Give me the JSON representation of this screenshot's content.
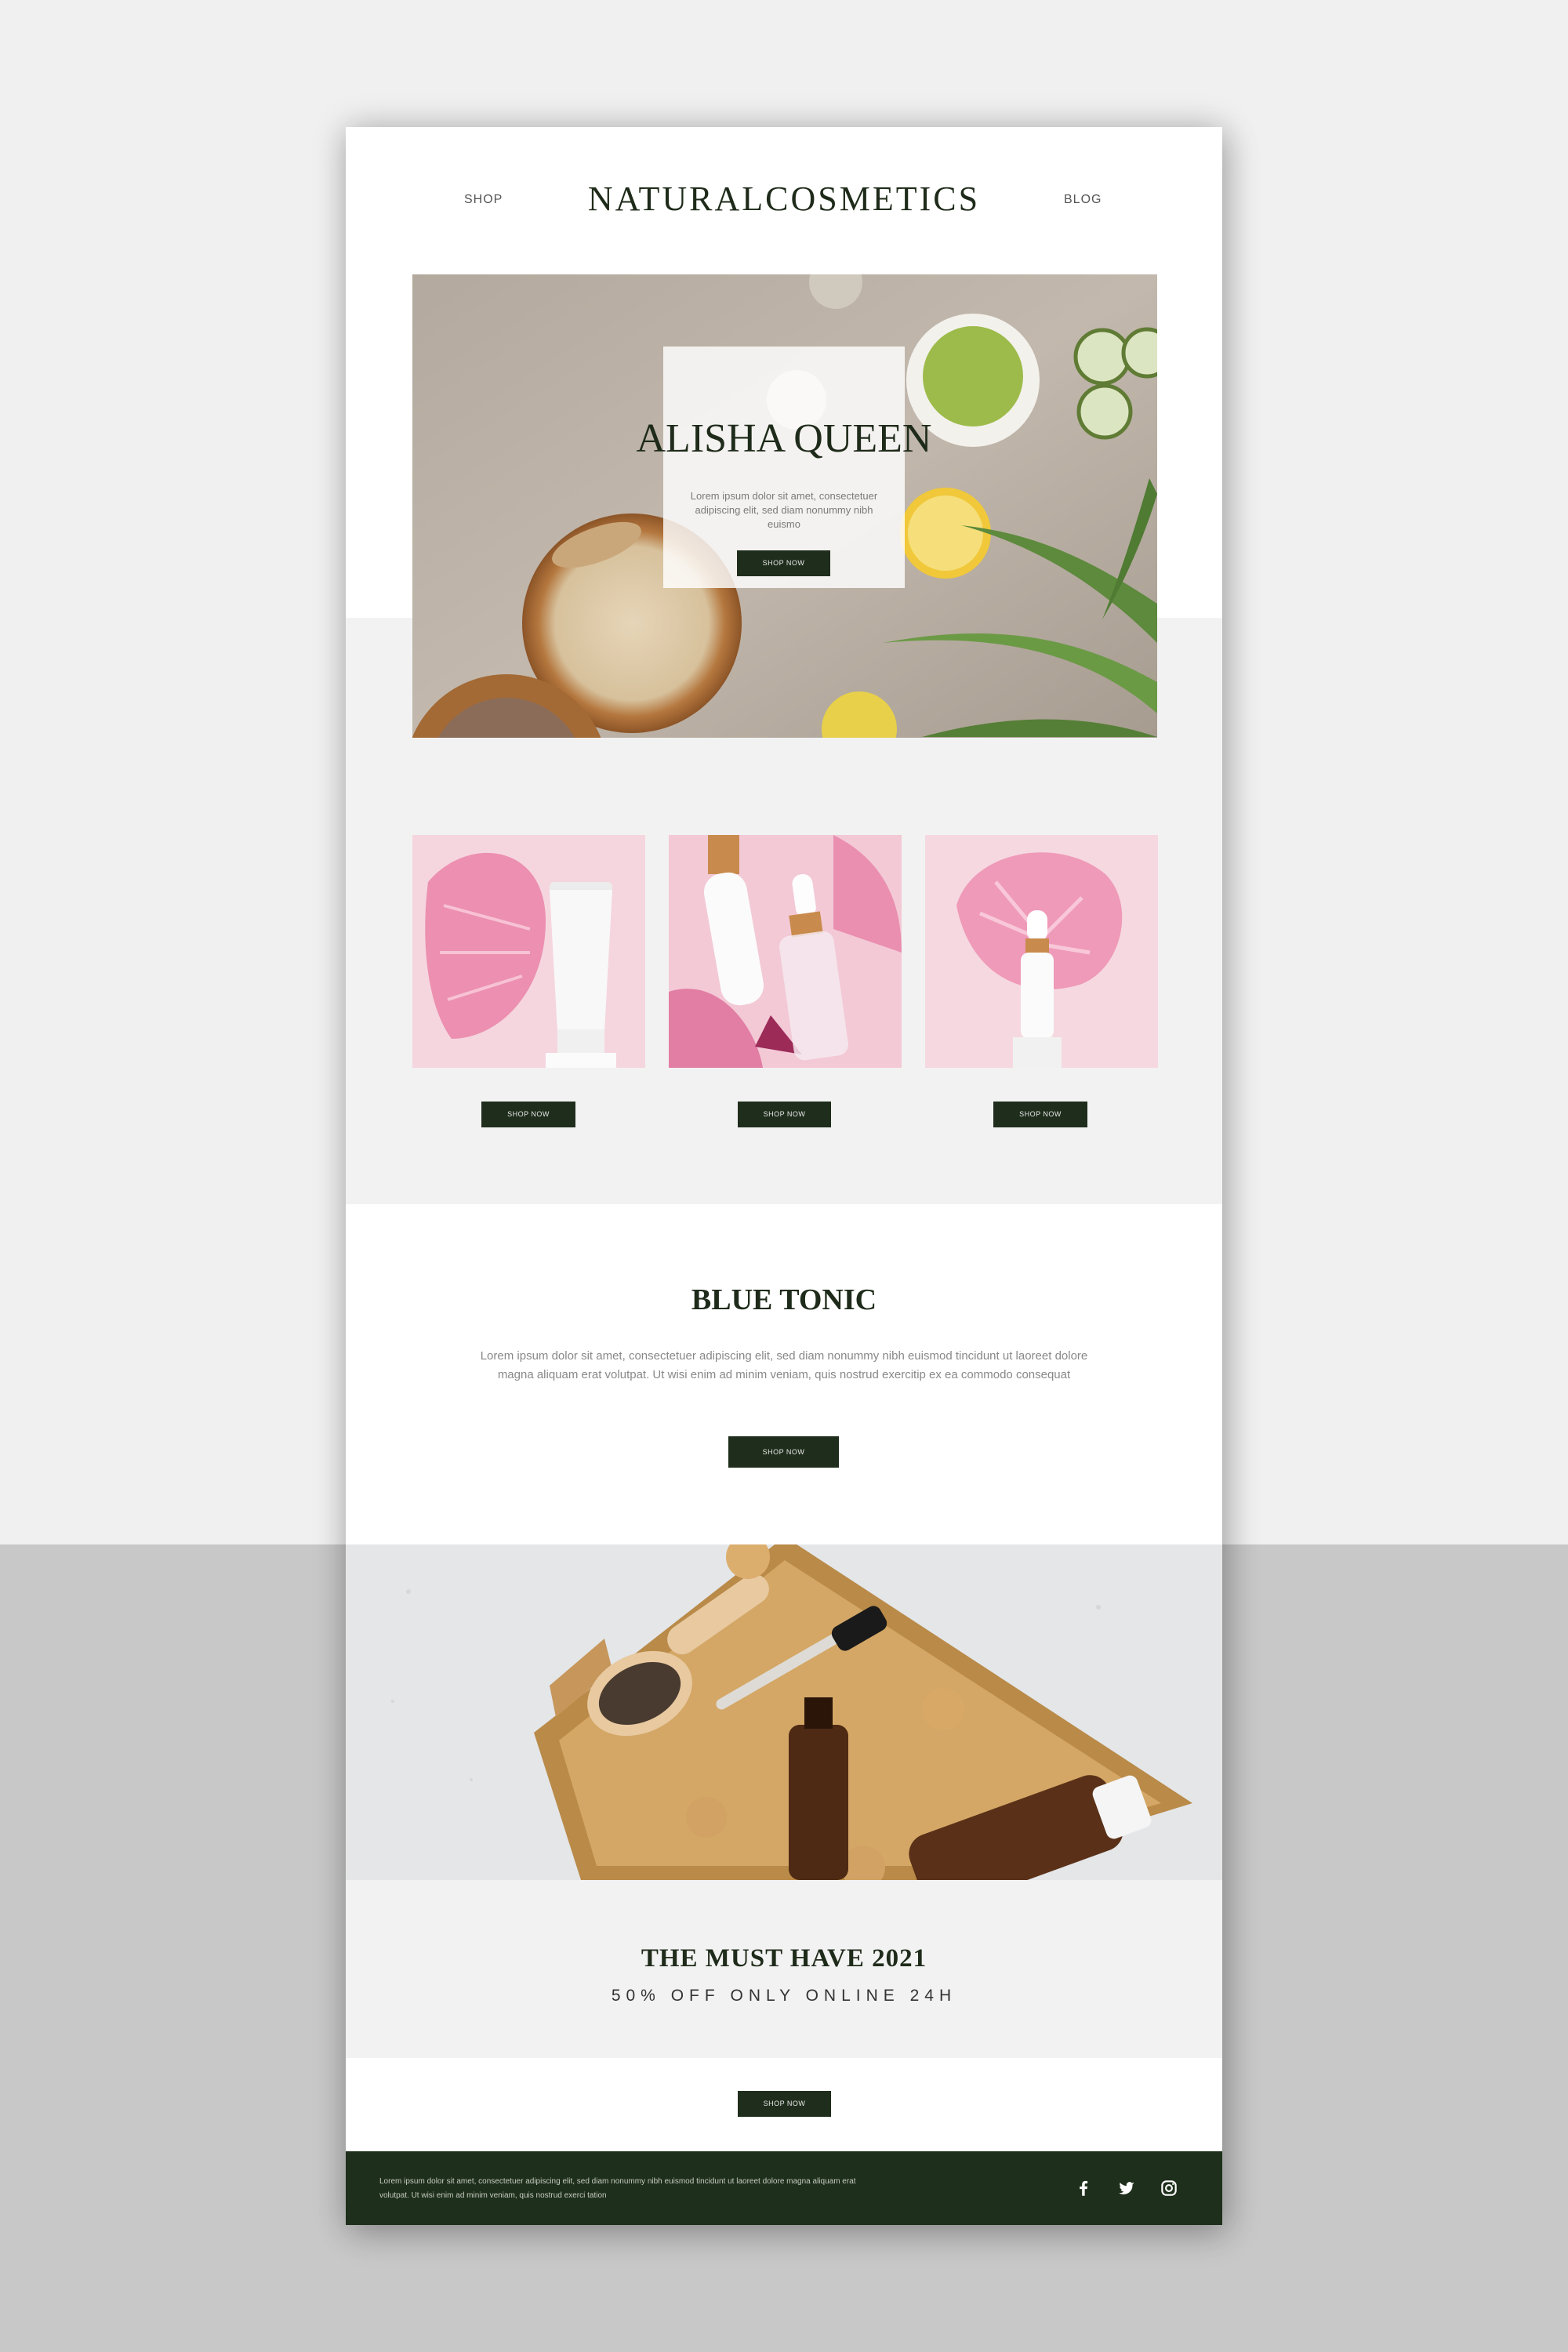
{
  "header": {
    "shop_link": "SHOP",
    "brand": "NATURALCOSMETICS",
    "blog_link": "BLOG"
  },
  "hero": {
    "title": "ALISHA QUEEN",
    "text": "Lorem ipsum dolor sit amet, consectetuer adipiscing elit, sed diam nonummy nibh euismo",
    "button": "SHOP NOW"
  },
  "products": [
    {
      "button": "SHOP NOW"
    },
    {
      "button": "SHOP NOW"
    },
    {
      "button": "SHOP NOW"
    }
  ],
  "feature": {
    "title": "BLUE TONIC",
    "text": "Lorem ipsum dolor sit amet, consectetuer adipiscing elit, sed diam nonummy nibh euismod tincidunt ut laoreet dolore magna aliquam erat volutpat. Ut wisi enim ad minim veniam, quis nostrud exercitip ex ea commodo consequat",
    "button": "SHOP NOW"
  },
  "promo": {
    "title": "THE MUST HAVE 2021",
    "subtitle": "50% OFF ONLY ONLINE 24H",
    "button": "SHOP NOW"
  },
  "footer": {
    "text": "Lorem ipsum dolor sit amet, consectetuer adipiscing elit, sed diam nonummy nibh euismod tincidunt ut laoreet dolore magna aliquam erat volutpat. Ut wisi enim ad minim veniam, quis nostrud exerci tation",
    "social_icons": [
      "facebook-icon",
      "twitter-icon",
      "instagram-icon"
    ]
  },
  "colors": {
    "accent_dark_green": "#1f2e1c",
    "page_background": "#f0f0f0",
    "lower_background": "#c8c8c8",
    "panel_grey": "#f2f2f2"
  }
}
